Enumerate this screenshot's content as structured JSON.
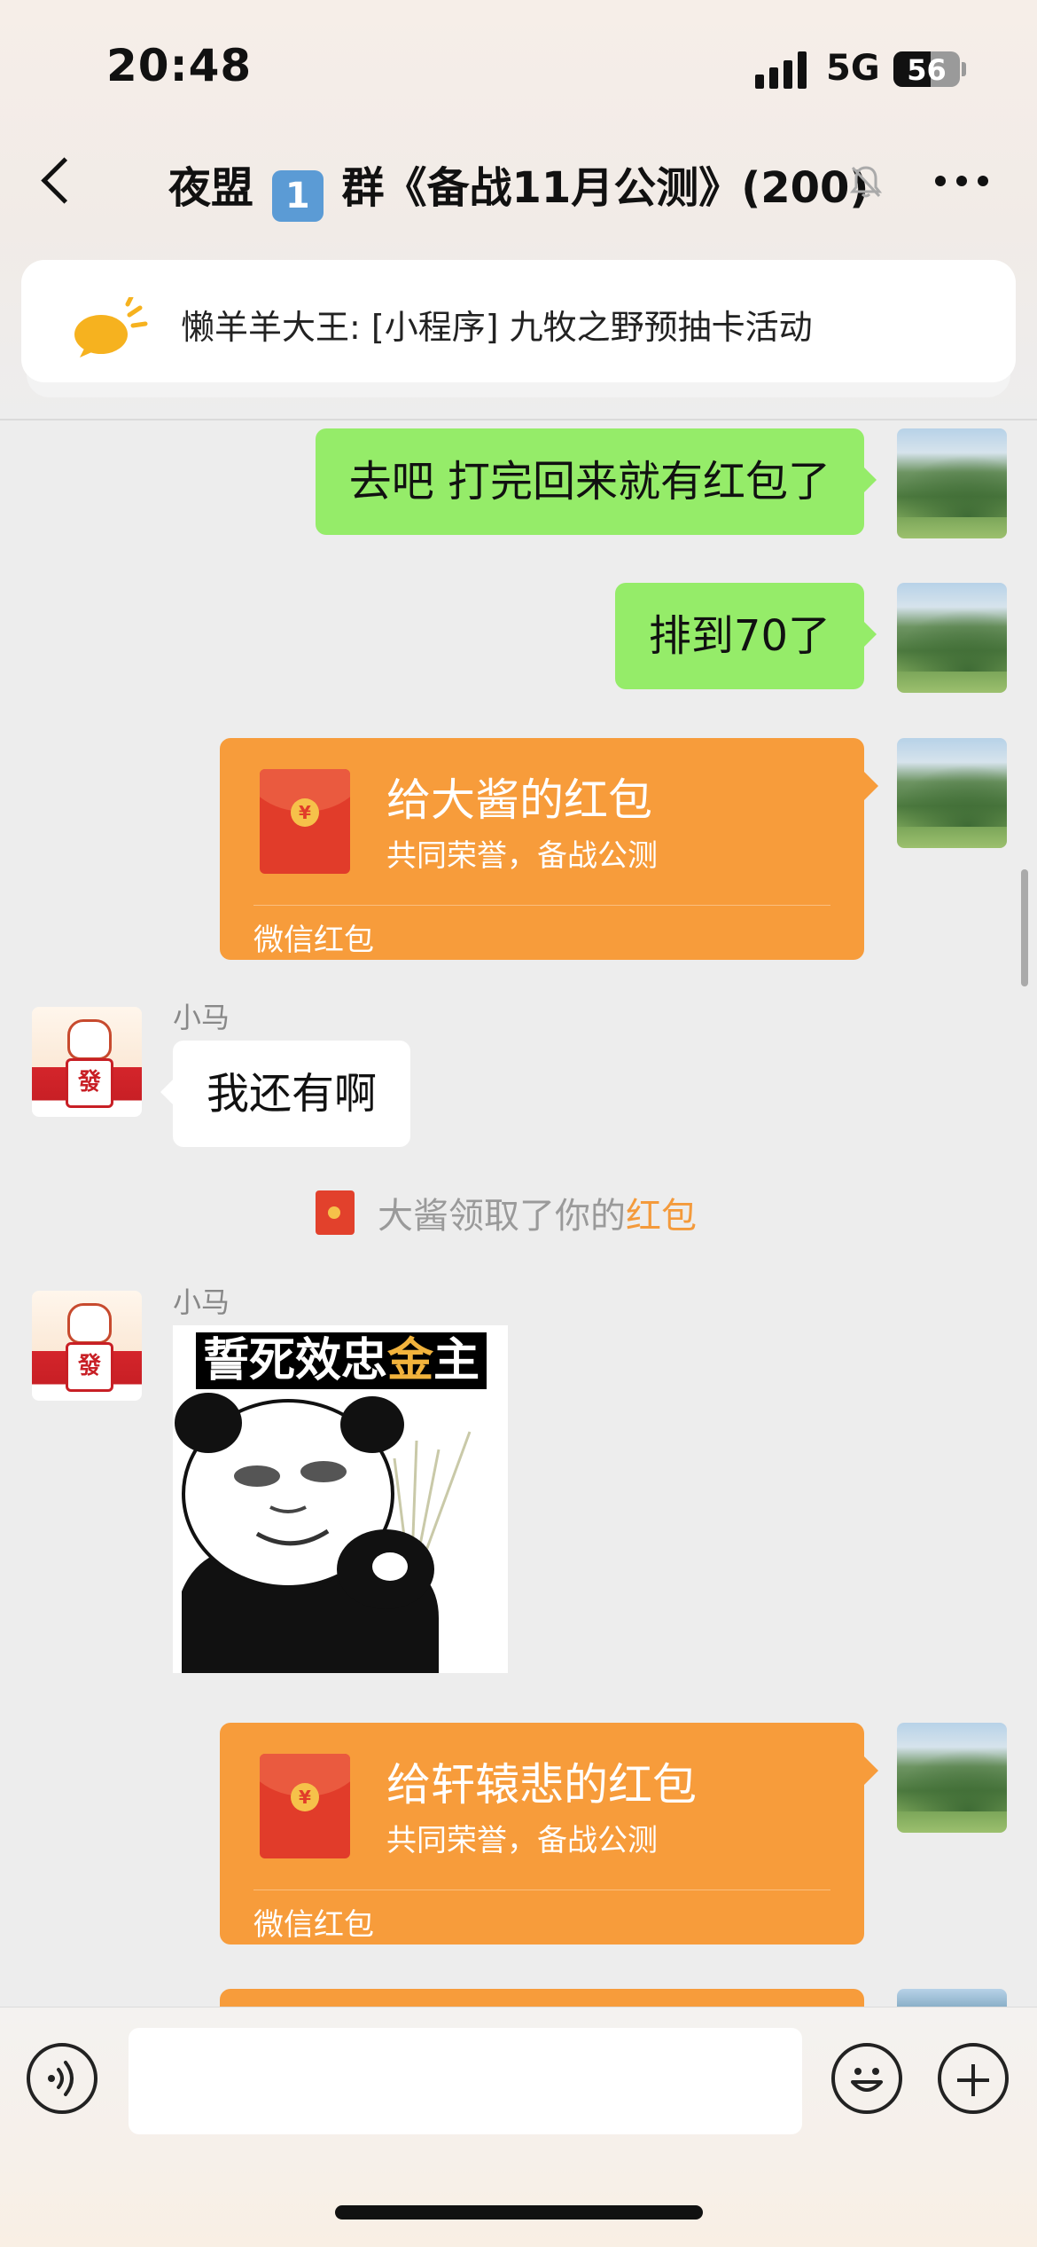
{
  "status_bar": {
    "time": "20:48",
    "network": "5G",
    "battery": "56",
    "battery_level": 0.56
  },
  "nav": {
    "title_prefix": "夜盟",
    "title_keycap": "1",
    "title_suffix": "群《备战11月公测》(200)"
  },
  "pinned_notice": {
    "text": "懒羊羊大王: [小程序] 九牧之野预抽卡活动"
  },
  "messages": [
    {
      "type": "text",
      "side": "me",
      "text": "去吧 打完回来就有红包了"
    },
    {
      "type": "text",
      "side": "me",
      "text": "排到70了"
    },
    {
      "type": "red_packet",
      "side": "me",
      "title": "给大酱的红包",
      "subtitle": "共同荣誉，备战公测",
      "footer": "微信红包"
    },
    {
      "type": "text",
      "side": "other",
      "sender": "小马",
      "text": "我还有啊"
    },
    {
      "type": "system",
      "text": "大酱领取了你的",
      "link": "红包"
    },
    {
      "type": "sticker",
      "side": "other",
      "sender": "小马",
      "caption_a": "誓死效忠",
      "caption_gold": "金",
      "caption_b": "主"
    },
    {
      "type": "red_packet",
      "side": "me",
      "title": "给轩辕悲的红包",
      "subtitle": "共同荣誉，备战公测",
      "footer": "微信红包"
    }
  ],
  "colors": {
    "bubble_me": "#95ec69",
    "red_packet": "#f79c3b",
    "link": "#f49a3b",
    "background": "#ededed"
  },
  "icons": [
    "back-chevron-icon",
    "mute-bell-icon",
    "more-icon",
    "announcement-icon",
    "voice-icon",
    "emoji-icon",
    "plus-icon"
  ]
}
